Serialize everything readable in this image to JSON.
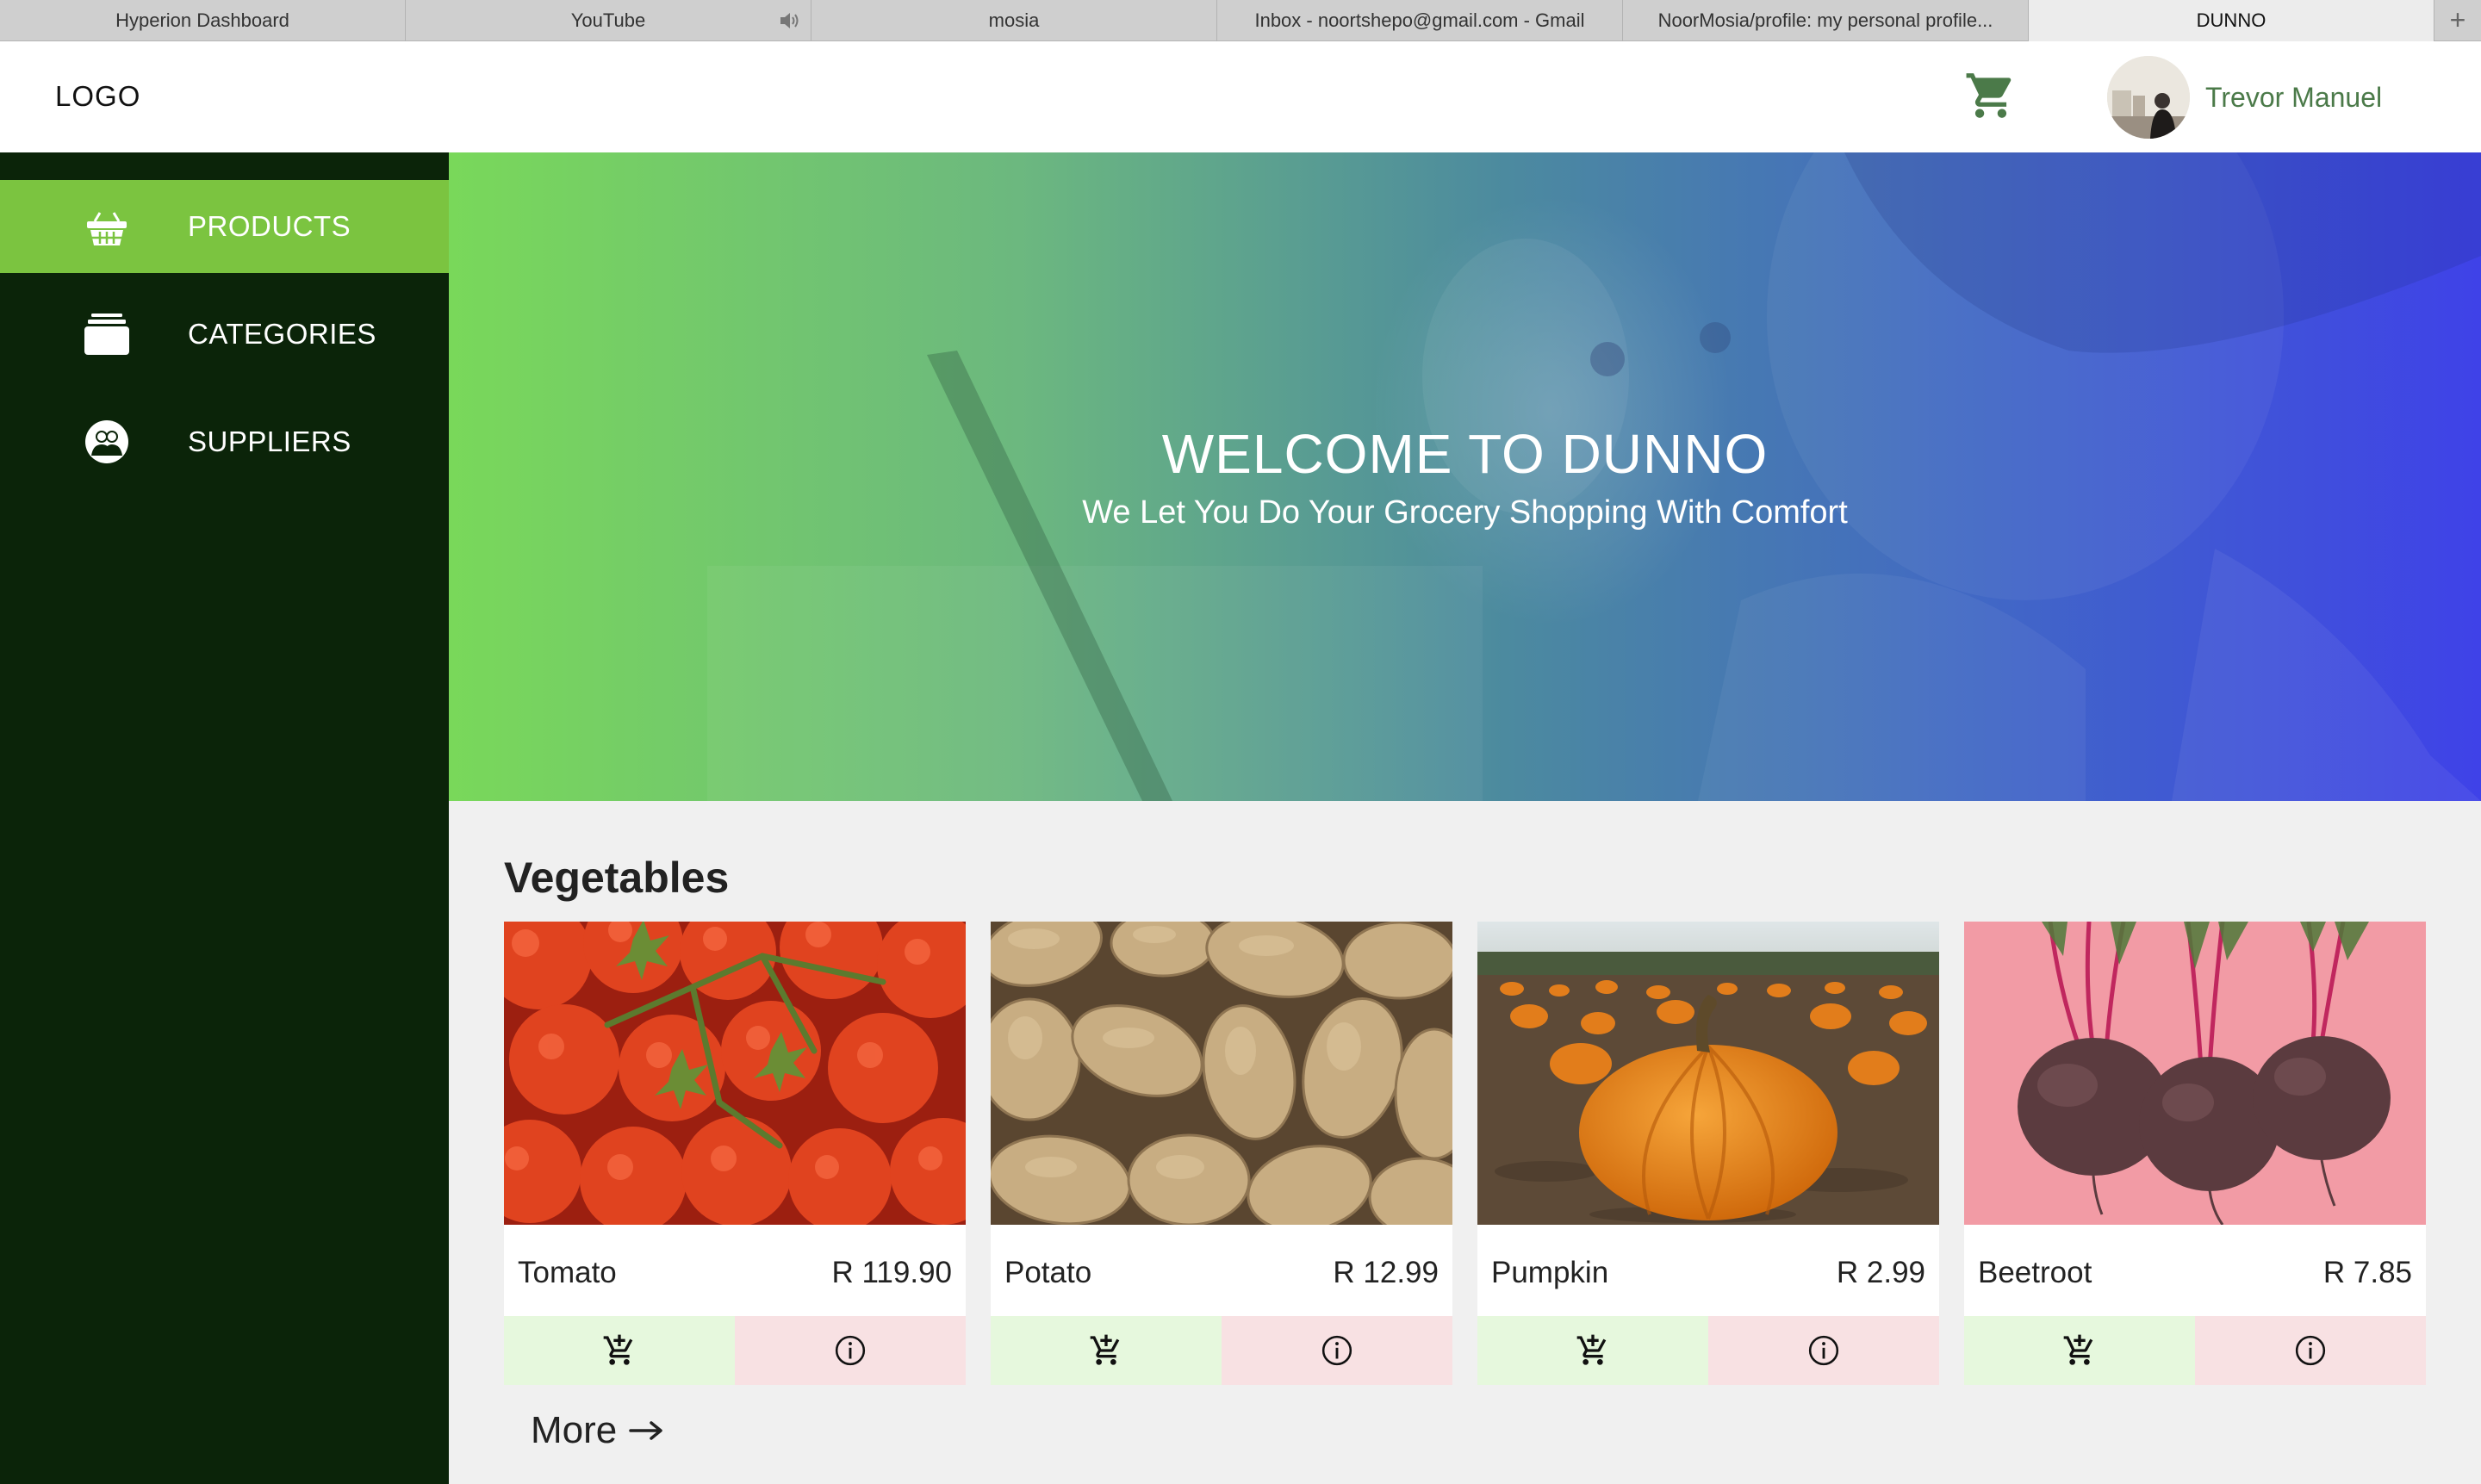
{
  "browser": {
    "tabs": [
      {
        "label": "Hyperion Dashboard"
      },
      {
        "label": "YouTube"
      },
      {
        "label": "mosia"
      },
      {
        "label": "Inbox - noortshepo@gmail.com - Gmail"
      },
      {
        "label": "NoorMosia/profile: my personal profile..."
      },
      {
        "label": "DUNNO"
      }
    ],
    "new_tab_label": "+"
  },
  "header": {
    "logo": "LOGO",
    "user_name": "Trevor Manuel",
    "icons": {
      "cart": "shopping-cart-icon",
      "avatar": "user-avatar"
    }
  },
  "sidebar": {
    "items": [
      {
        "label": "PRODUCTS",
        "icon": "basket-icon",
        "active": true
      },
      {
        "label": "CATEGORIES",
        "icon": "stack-icon",
        "active": false
      },
      {
        "label": "SUPPLIERS",
        "icon": "people-icon",
        "active": false
      }
    ]
  },
  "hero": {
    "title": "WELCOME TO DUNNO",
    "subtitle": "We Let You Do Your Grocery Shopping With Comfort"
  },
  "section": {
    "title": "Vegetables",
    "more_label": "More"
  },
  "products": [
    {
      "name": "Tomato",
      "price": "R 119.90"
    },
    {
      "name": "Potato",
      "price": "R 12.99"
    },
    {
      "name": "Pumpkin",
      "price": "R 2.99"
    },
    {
      "name": "Beetroot",
      "price": "R 7.85"
    }
  ],
  "colors": {
    "sidebar": "#0b2409",
    "active_nav": "#7bc440",
    "cart_button_bg": "#e6f8dd",
    "info_button_bg": "#f8e1e3",
    "username": "#4b7a49"
  }
}
